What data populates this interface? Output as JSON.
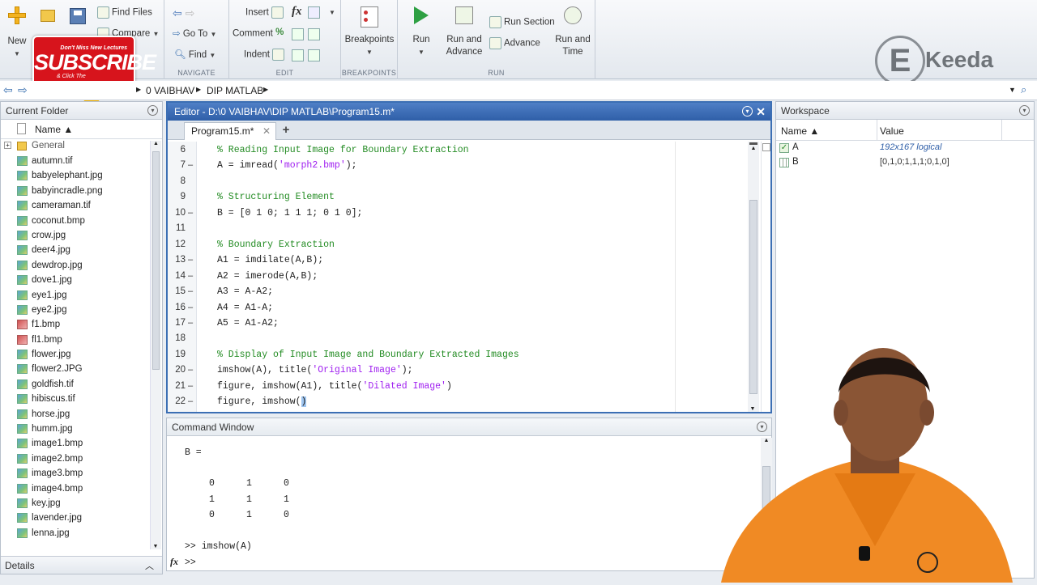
{
  "toolstrip": {
    "new_label": "New",
    "find_files": "Find Files",
    "compare": "Compare",
    "goto": "Go To",
    "find": "Find",
    "navigate_label": "NAVIGATE",
    "insert": "Insert",
    "comment": "Comment",
    "indent": "Indent",
    "fx": "fx",
    "edit_label": "EDIT",
    "breakpoints": "Breakpoints",
    "breakpoints_label": "BREAKPOINTS",
    "run": "Run",
    "run_advance_1": "Run and",
    "run_advance_2": "Advance",
    "run_section": "Run Section",
    "advance": "Advance",
    "run_time_1": "Run and",
    "run_time_2": "Time",
    "run_label": "RUN"
  },
  "overlay": {
    "subscribe": "SUBSCRIBE",
    "subscribe_top": "Don't Miss New Lectures",
    "subscribe_bottom": "& Click The",
    "brand": "Keeda",
    "brand_letter": "E"
  },
  "address": {
    "crumb1": "0 VAIBHAV",
    "crumb2": "DIP MATLAB"
  },
  "current_folder": {
    "title": "Current Folder",
    "col_name": "Name ▲",
    "group": "General",
    "files": [
      {
        "name": "autumn.tif",
        "type": "img"
      },
      {
        "name": "babyelephant.jpg",
        "type": "img"
      },
      {
        "name": "babyincradle.png",
        "type": "img"
      },
      {
        "name": "cameraman.tif",
        "type": "img"
      },
      {
        "name": "coconut.bmp",
        "type": "img"
      },
      {
        "name": "crow.jpg",
        "type": "img"
      },
      {
        "name": "deer4.jpg",
        "type": "img"
      },
      {
        "name": "dewdrop.jpg",
        "type": "img"
      },
      {
        "name": "dove1.jpg",
        "type": "img"
      },
      {
        "name": "eye1.jpg",
        "type": "img"
      },
      {
        "name": "eye2.jpg",
        "type": "img"
      },
      {
        "name": "f1.bmp",
        "type": "bmp"
      },
      {
        "name": "fl1.bmp",
        "type": "bmp"
      },
      {
        "name": "flower.jpg",
        "type": "img"
      },
      {
        "name": "flower2.JPG",
        "type": "img"
      },
      {
        "name": "goldfish.tif",
        "type": "img"
      },
      {
        "name": "hibiscus.tif",
        "type": "img"
      },
      {
        "name": "horse.jpg",
        "type": "img"
      },
      {
        "name": "humm.jpg",
        "type": "img"
      },
      {
        "name": "image1.bmp",
        "type": "img"
      },
      {
        "name": "image2.bmp",
        "type": "img"
      },
      {
        "name": "image3.bmp",
        "type": "img"
      },
      {
        "name": "image4.bmp",
        "type": "img"
      },
      {
        "name": "key.jpg",
        "type": "img"
      },
      {
        "name": "lavender.jpg",
        "type": "img"
      },
      {
        "name": "lenna.jpg",
        "type": "img"
      }
    ],
    "details": "Details"
  },
  "editor": {
    "title": "Editor - D:\\0 VAIBHAV\\DIP MATLAB\\Program15.m*",
    "tab": "Program15.m*",
    "lines": [
      {
        "n": "6",
        "dash": false,
        "parts": [
          {
            "t": "% Reading Input Image for Boundary Extraction",
            "c": "cmt"
          }
        ]
      },
      {
        "n": "7",
        "dash": true,
        "parts": [
          {
            "t": "A = imread(",
            "c": ""
          },
          {
            "t": "'morph2.bmp'",
            "c": "str"
          },
          {
            "t": ");",
            "c": ""
          }
        ]
      },
      {
        "n": "8",
        "dash": false,
        "parts": []
      },
      {
        "n": "9",
        "dash": false,
        "parts": [
          {
            "t": "% Structuring Element",
            "c": "cmt"
          }
        ]
      },
      {
        "n": "10",
        "dash": true,
        "parts": [
          {
            "t": "B = [0 1 0; 1 1 1; 0 1 0];",
            "c": ""
          }
        ]
      },
      {
        "n": "11",
        "dash": false,
        "parts": []
      },
      {
        "n": "12",
        "dash": false,
        "parts": [
          {
            "t": "% Boundary Extraction",
            "c": "cmt"
          }
        ]
      },
      {
        "n": "13",
        "dash": true,
        "parts": [
          {
            "t": "A1 = imdilate(A,B);",
            "c": ""
          }
        ]
      },
      {
        "n": "14",
        "dash": true,
        "parts": [
          {
            "t": "A2 = imerode(A,B);",
            "c": ""
          }
        ]
      },
      {
        "n": "15",
        "dash": true,
        "parts": [
          {
            "t": "A3 = A-A2;",
            "c": ""
          }
        ]
      },
      {
        "n": "16",
        "dash": true,
        "parts": [
          {
            "t": "A4 = A1-A;",
            "c": ""
          }
        ]
      },
      {
        "n": "17",
        "dash": true,
        "parts": [
          {
            "t": "A5 = A1-A2;",
            "c": ""
          }
        ]
      },
      {
        "n": "18",
        "dash": false,
        "parts": []
      },
      {
        "n": "19",
        "dash": false,
        "parts": [
          {
            "t": "% Display of Input Image and Boundary Extracted Images",
            "c": "cmt"
          }
        ]
      },
      {
        "n": "20",
        "dash": true,
        "parts": [
          {
            "t": "imshow(A), title(",
            "c": ""
          },
          {
            "t": "'Original Image'",
            "c": "str"
          },
          {
            "t": ");",
            "c": ""
          }
        ]
      },
      {
        "n": "21",
        "dash": true,
        "parts": [
          {
            "t": "figure, imshow(A1), title(",
            "c": ""
          },
          {
            "t": "'Dilated Image'",
            "c": "str"
          },
          {
            "t": ")",
            "c": ""
          }
        ]
      },
      {
        "n": "22",
        "dash": true,
        "parts": [
          {
            "t": "figure, imshow(",
            "c": ""
          },
          {
            "t": ")",
            "c": "cursor"
          }
        ]
      }
    ]
  },
  "command_window": {
    "title": "Command Window",
    "var_line": "B =",
    "matrix": [
      [
        "0",
        "1",
        "0"
      ],
      [
        "1",
        "1",
        "1"
      ],
      [
        "0",
        "1",
        "0"
      ]
    ],
    "history": ">> imshow(A)",
    "prompt": ">>",
    "fx": "fx"
  },
  "workspace": {
    "title": "Workspace",
    "col_name": "Name ▲",
    "col_value": "Value",
    "vars": [
      {
        "name": "A",
        "value": "192x167 logical",
        "kind": "logical"
      },
      {
        "name": "B",
        "value": "[0,1,0;1,1,1;0,1,0]",
        "kind": "double"
      }
    ]
  },
  "colors": {
    "accent": "#2f5fa8",
    "comment": "#228b22",
    "string": "#a020f0",
    "subscribe_red": "#d7141c"
  }
}
